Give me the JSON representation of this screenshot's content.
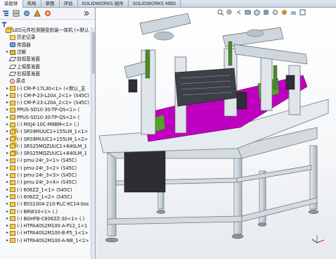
{
  "tabs": [
    "装配体",
    "布局",
    "草图",
    "评估",
    "SOLIDWORKS 插件",
    "SOLIDWORKS MBD"
  ],
  "panel": {
    "rows": [
      {
        "label": "LED元件检测摆盘封装一体机 (<默认",
        "icon": "asm",
        "exp": "",
        "indent": 0
      },
      {
        "label": "历史记录",
        "icon": "folder",
        "exp": "",
        "indent": 1
      },
      {
        "label": "传感器",
        "icon": "sensor",
        "exp": "",
        "indent": 1
      },
      {
        "label": "注解",
        "icon": "note",
        "exp": "▸",
        "indent": 1
      },
      {
        "label": "前视基准面",
        "icon": "plane",
        "exp": "",
        "indent": 1
      },
      {
        "label": "上视基准面",
        "icon": "plane",
        "exp": "",
        "indent": 1
      },
      {
        "label": "右视基准面",
        "icon": "plane",
        "exp": "",
        "indent": 1
      },
      {
        "label": "原点",
        "icon": "origin",
        "exp": "",
        "indent": 1
      },
      {
        "label": "(-) CM-P-17L30<1> (<默认_显",
        "icon": "part",
        "exp": "▸",
        "indent": 1
      },
      {
        "label": "(-) CM-P-23-L20A_2<1> (S45C)",
        "icon": "part",
        "exp": "▸",
        "indent": 1
      },
      {
        "label": "(-) CM-P-23-L20A_2<2> (S45C)",
        "icon": "part",
        "exp": "▸",
        "indent": 1
      },
      {
        "label": "PPUS-SD10-30-TP-QS<1> (",
        "icon": "part",
        "exp": "▸",
        "indent": 1
      },
      {
        "label": "PPUS-SD10-30-TP-QS<2> (",
        "icon": "part",
        "exp": "▸",
        "indent": 1
      },
      {
        "label": "(-) MXJ4-10C-M9BM<1> (.)",
        "icon": "part",
        "exp": "▸",
        "indent": 1
      },
      {
        "label": "(-) SRS9MUUC1+155LM_1<1>",
        "icon": "asm",
        "exp": "▸",
        "indent": 1
      },
      {
        "label": "(-) SRS9MUUC1+155LM_1<2>",
        "icon": "asm",
        "exp": "▸",
        "indent": 1
      },
      {
        "label": "(-) SRS25MQZUUC1+640LM_1",
        "icon": "asm",
        "exp": "▸",
        "indent": 1
      },
      {
        "label": "(-) SRS25MQZUUC1+640LM_1",
        "icon": "asm",
        "exp": "▸",
        "indent": 1
      },
      {
        "label": "(-) pmu-24r_3<1> (S45C)",
        "icon": "part",
        "exp": "▸",
        "indent": 1
      },
      {
        "label": "(-) pmu-24r_3<2> (S45C)",
        "icon": "part",
        "exp": "▸",
        "indent": 1
      },
      {
        "label": "(-) pmu-24r_3<3> (S45C)",
        "icon": "part",
        "exp": "▸",
        "indent": 1
      },
      {
        "label": "(-) pmu-24r_3<4> (S45C)",
        "icon": "part",
        "exp": "▸",
        "indent": 1
      },
      {
        "label": "(-) 606ZZ_1<1> (S45C)",
        "icon": "part",
        "exp": "▸",
        "indent": 1
      },
      {
        "label": "(-) 606ZZ_1<2> (S45C)",
        "icon": "part",
        "exp": "▸",
        "indent": 1
      },
      {
        "label": "(-) BSS1004-210-RLC-KC14-bss",
        "icon": "part",
        "exp": "▸",
        "indent": 1
      },
      {
        "label": "(-) BRW10<1> (.)",
        "icon": "part",
        "exp": "▸",
        "indent": 1
      },
      {
        "label": "(-) BGHFB-C606ZZ-30<1> (.)",
        "icon": "part",
        "exp": "▸",
        "indent": 1
      },
      {
        "label": "(-) HTPA40S2M100-A-P12_1<1",
        "icon": "part",
        "exp": "▸",
        "indent": 1
      },
      {
        "label": "(-) HTPA40S2M100-B-P5_1<1>",
        "icon": "part",
        "exp": "▸",
        "indent": 1
      },
      {
        "label": "(-) HTPA40S2M100-A-N8_1<1>",
        "icon": "part",
        "exp": "▸",
        "indent": 1
      }
    ]
  },
  "colors": {
    "frame": "#b9c4cc",
    "magenta": "#c000c0",
    "green": "#5aa02c",
    "dark": "#404048",
    "panel_bg": "#f7f8fa"
  }
}
